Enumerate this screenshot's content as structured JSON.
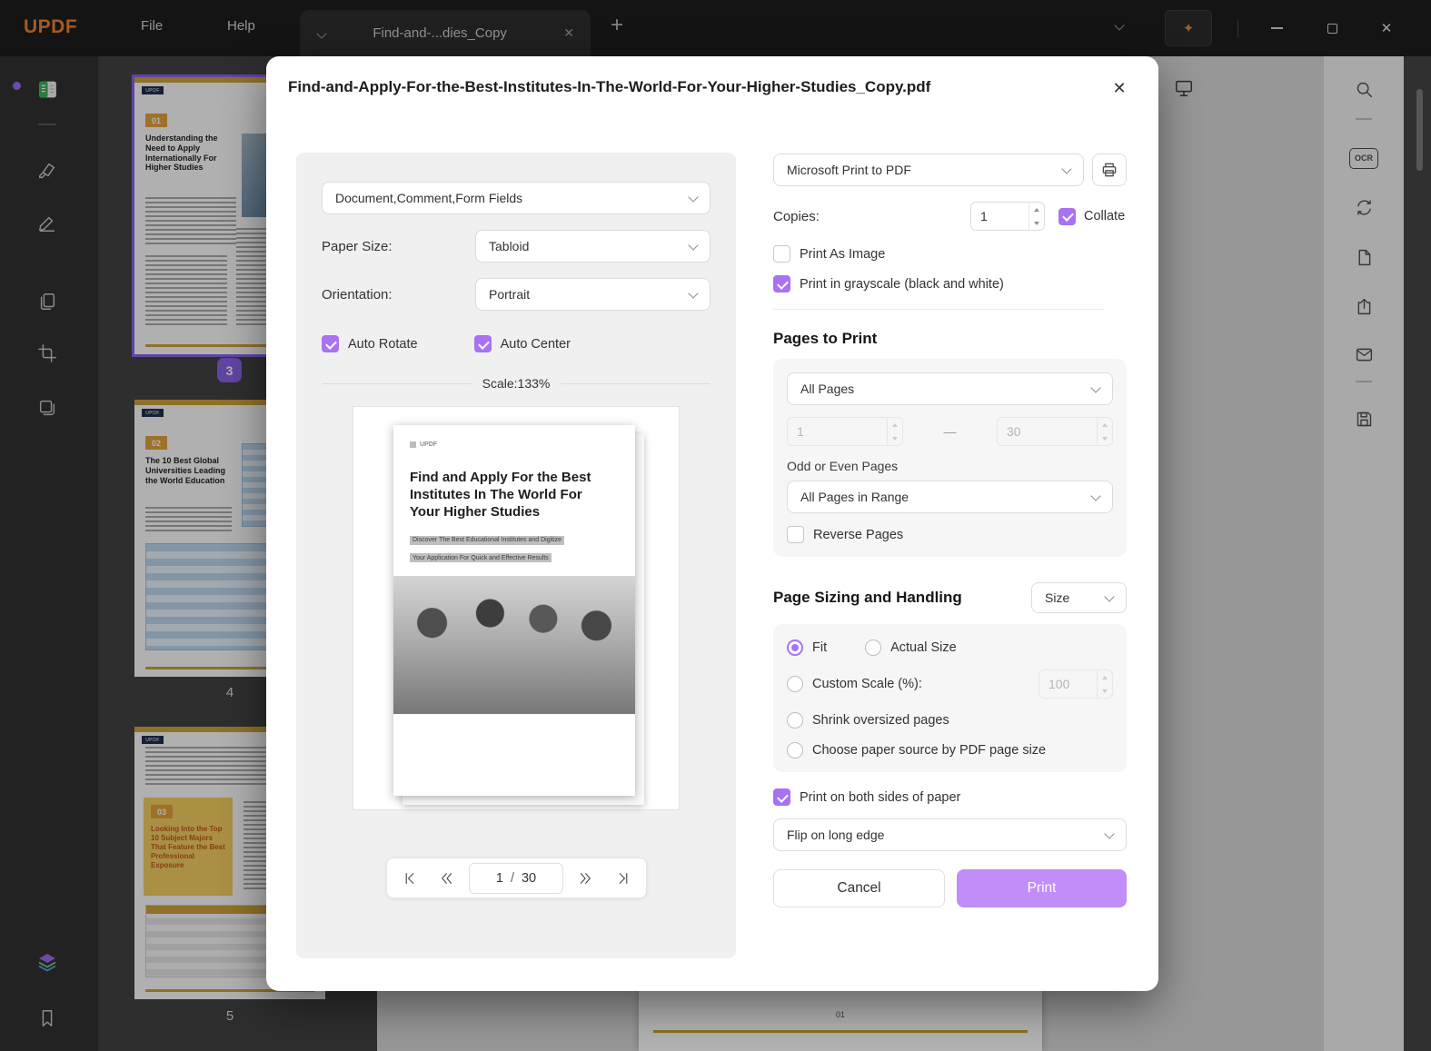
{
  "icons": {
    "close": "✕",
    "plus": "+",
    "dash": "—",
    "sparkle": "✦"
  },
  "titlebar": {
    "logo": "UPDF",
    "menus": [
      {
        "label": "File"
      },
      {
        "label": "Help"
      }
    ],
    "tab": {
      "label": "Find-and-...dies_Copy"
    }
  },
  "right_toolbar": {
    "ocr": "OCR"
  },
  "thumbnail_panel": {
    "brand": "UPDF",
    "pages": [
      {
        "badge": "01",
        "title": "Understanding the Need to Apply Internationally For Higher Studies",
        "page_num": "3"
      },
      {
        "badge": "02",
        "title": "The 10 Best Global Universities Leading the World Education",
        "page_num": "4"
      },
      {
        "badge": "03",
        "title": "Looking Into the Top 10 Subject Majors That Feature the Best Professional Exposure",
        "page_num": "5"
      }
    ]
  },
  "document_area": {
    "page_label": "01"
  },
  "dialog": {
    "title": "Find-and-Apply-For-the-Best-Institutes-In-The-World-For-Your-Higher-Studies_Copy.pdf",
    "content_select": "Document,Comment,Form Fields",
    "paper_size_label": "Paper Size:",
    "paper_size_value": "Tabloid",
    "orientation_label": "Orientation:",
    "orientation_value": "Portrait",
    "auto_rotate_label": "Auto Rotate",
    "auto_center_label": "Auto Center",
    "scale_text": "Scale:133%",
    "preview": {
      "brand": "UPDF",
      "title": "Find and Apply For the Best Institutes In The World For Your Higher Studies",
      "subtitle_1": "Discover The Best Educational Institutes and Digitize",
      "subtitle_2": "Your Application For Quick and Effective Results"
    },
    "pagination": {
      "current": "1",
      "separator": "/",
      "total": "30"
    },
    "printer_value": "Microsoft Print to PDF",
    "copies_label": "Copies:",
    "copies_value": "1",
    "collate_label": "Collate",
    "print_as_image_label": "Print As Image",
    "grayscale_label": "Print in grayscale (black and white)",
    "pages_to_print": {
      "heading": "Pages to Print",
      "range_value": "All Pages",
      "from_value": "1",
      "to_value": "30",
      "odd_even_label": "Odd or Even Pages",
      "odd_even_value": "All Pages in Range",
      "reverse_label": "Reverse Pages"
    },
    "sizing": {
      "heading": "Page Sizing and Handling",
      "mode_value": "Size",
      "fit_label": "Fit",
      "actual_label": "Actual Size",
      "custom_label": "Custom Scale (%):",
      "custom_value": "100",
      "shrink_label": "Shrink oversized pages",
      "source_label": "Choose paper source by PDF page size"
    },
    "both_sides_label": "Print on both sides of paper",
    "flip_value": "Flip on long edge",
    "cancel_label": "Cancel",
    "print_label": "Print"
  }
}
